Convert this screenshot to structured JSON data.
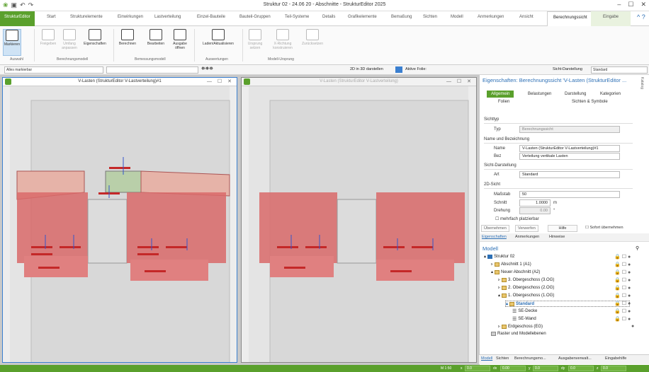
{
  "window": {
    "title": "Struktur 02 - 24.06 20 - Abschnitte - StrukturEditor 2025"
  },
  "tabs": [
    "StrukturEditor",
    "Start",
    "Strukturelemente",
    "Einwirkungen",
    "Lastverteilung",
    "Einzel-Bauteile",
    "Bauteil-Gruppen",
    "Teil-Systeme",
    "Details",
    "Grafikelemente",
    "Bemaßung",
    "Sichten",
    "Modell",
    "Anmerkungen",
    "Ansicht",
    "Berechnungssicht",
    "Eingabe"
  ],
  "ribbon": {
    "buttons": [
      "Markieren",
      "Freigeben",
      "Umfang anpassen",
      "Eigenschaften",
      "Berechnen",
      "Bearbeiten",
      "Ausgabe öffnen",
      "Laden/Aktualisieren",
      "Ursprung setzen",
      "X-Richtung konstruieren",
      "Zurücksetzen"
    ],
    "groups": [
      "Auswahl",
      "Berechnungsmodell",
      "Bemessungsmodell",
      "Auswertungen",
      "Modell-Ursprung"
    ]
  },
  "toolbar2": {
    "selection": "Alles markierbar",
    "view2d": "2D in 3D darstellen",
    "active_folie": "Aktive Folie:",
    "sicht_label": "Sicht-Darstellung",
    "sicht_value": "Standard"
  },
  "views": [
    {
      "title": "V-Lasten (StrukturEditor V-Lastverteilung)#1",
      "controls": "— ☐ ✕"
    },
    {
      "title": "V-Lasten (StrukturEditor V-Lastverteilung)",
      "controls": "— ☐ ✕"
    }
  ],
  "props": {
    "header": "Eigenschaften: Berechnungssicht 'V-Lasten (StrukturEditor ...",
    "tabs": [
      "Allgemein",
      "Belastungen",
      "Darstellung",
      "Kategorien",
      "Folien",
      "Sichten & Symbole"
    ],
    "sections": [
      "Sichttyp",
      "Name und Bezeichnung",
      "Sicht-Darstellung",
      "2D-Sicht"
    ],
    "typ_label": "Typ",
    "typ_value": "Berechnungssicht",
    "name_label": "Name",
    "name_value": "V-Lasten (StrukturEditor V-Lastverteilung)#1",
    "bez_label": "Bez",
    "bez_value": "Verteilung vertikale Lasten",
    "art_label": "Art",
    "art_value": "Standard",
    "massstab_label": "Maßstab",
    "massstab_value": "50",
    "schnitt_label": "Schnitt",
    "schnitt_value": "1.0000",
    "schnitt_unit": "m",
    "drehung_label": "Drehung",
    "drehung_value": "0.00",
    "drehung_unit": "°",
    "mehrfach": "mehrfach platzierbar",
    "buttons": [
      "Übernehmen",
      "Verwerfen",
      "Hilfe",
      "Sofort übernehmen"
    ],
    "subtabs": [
      "Eigenschaften",
      "Anmerkungen",
      "Hinweise"
    ],
    "vertical": "Katalog"
  },
  "model": {
    "title": "Modell",
    "tree": [
      "Struktur 02",
      "Abschnitt 1 (A1)",
      "Neuer Abschnitt (A2)",
      "3. Obergeschoss (3.OG)",
      "2. Obergeschoss (2.OG)",
      "1. Obergeschoss (1.OG)",
      "Standard",
      "SE-Decke",
      "SE-Wand",
      "Erdgeschoss (EG)",
      "Raster und Modellebenen"
    ],
    "bottom_tabs": [
      "Modell",
      "Sichten",
      "Berechnungsmo...",
      "Ausgabenverwalt...",
      "Eingabehilfe"
    ]
  },
  "status": {
    "scale": "M 1:50",
    "x_label": "x",
    "y_label": "y",
    "dx_label": "dx",
    "dy_label": "dy",
    "z_label": "z",
    "v1": "0.0",
    "v2": "0.00",
    "v3": "0.0"
  },
  "colors": {
    "accent": "#5aa02c",
    "wall": "#d96a6a",
    "load_label": "#c42828"
  }
}
